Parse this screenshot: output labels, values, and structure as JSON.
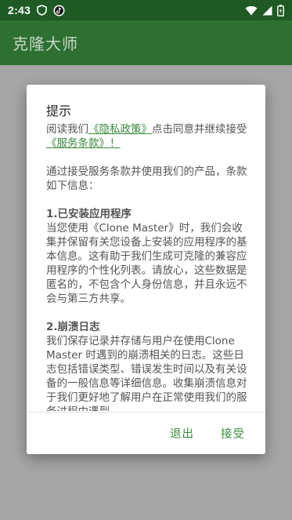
{
  "status_bar": {
    "time": "2:43",
    "icons": [
      "shield-icon",
      "tiktok-icon",
      "wifi-icon",
      "signal-icon",
      "battery-icon"
    ]
  },
  "app_bar": {
    "title": "克隆大师"
  },
  "dialog": {
    "title": "提示",
    "intro": {
      "part1": "阅读我们",
      "privacy_link": "《隐私政策》",
      "part2": "点击同意并继续接受",
      "terms_link": "《服务条款》！"
    },
    "lead": "通过接受服务条款并使用我们的产品，条款如下信息：",
    "sections": [
      {
        "heading": "1.已安装应用程序",
        "text": "当您使用《Clone Master》时，我们会收集并保留有关您设备上安装的应用程序的基本信息。这有助于我们生成可克隆的兼容应用程序的个性化列表。请放心，这些数据是匿名的，不包含个人身份信息，并且永远不会与第三方共享。"
      },
      {
        "heading": "2.崩溃日志",
        "text": "我们保存记录并存储与用户在使用Clone Master 时遇到的崩溃相关的日志。这些日志包括错误类型、错误发生时间以及有关设备的一般信息等详细信息。收集崩溃信息对于我们更好地了解用户在正常使用我们的服务过程中遇到"
      }
    ],
    "buttons": {
      "exit": "退出",
      "accept": "接受"
    }
  },
  "colors": {
    "status_bar": "#1f5a24",
    "app_bar": "#2e7032",
    "scrim": "#a6a6a6",
    "accent": "#3a8a3e"
  }
}
